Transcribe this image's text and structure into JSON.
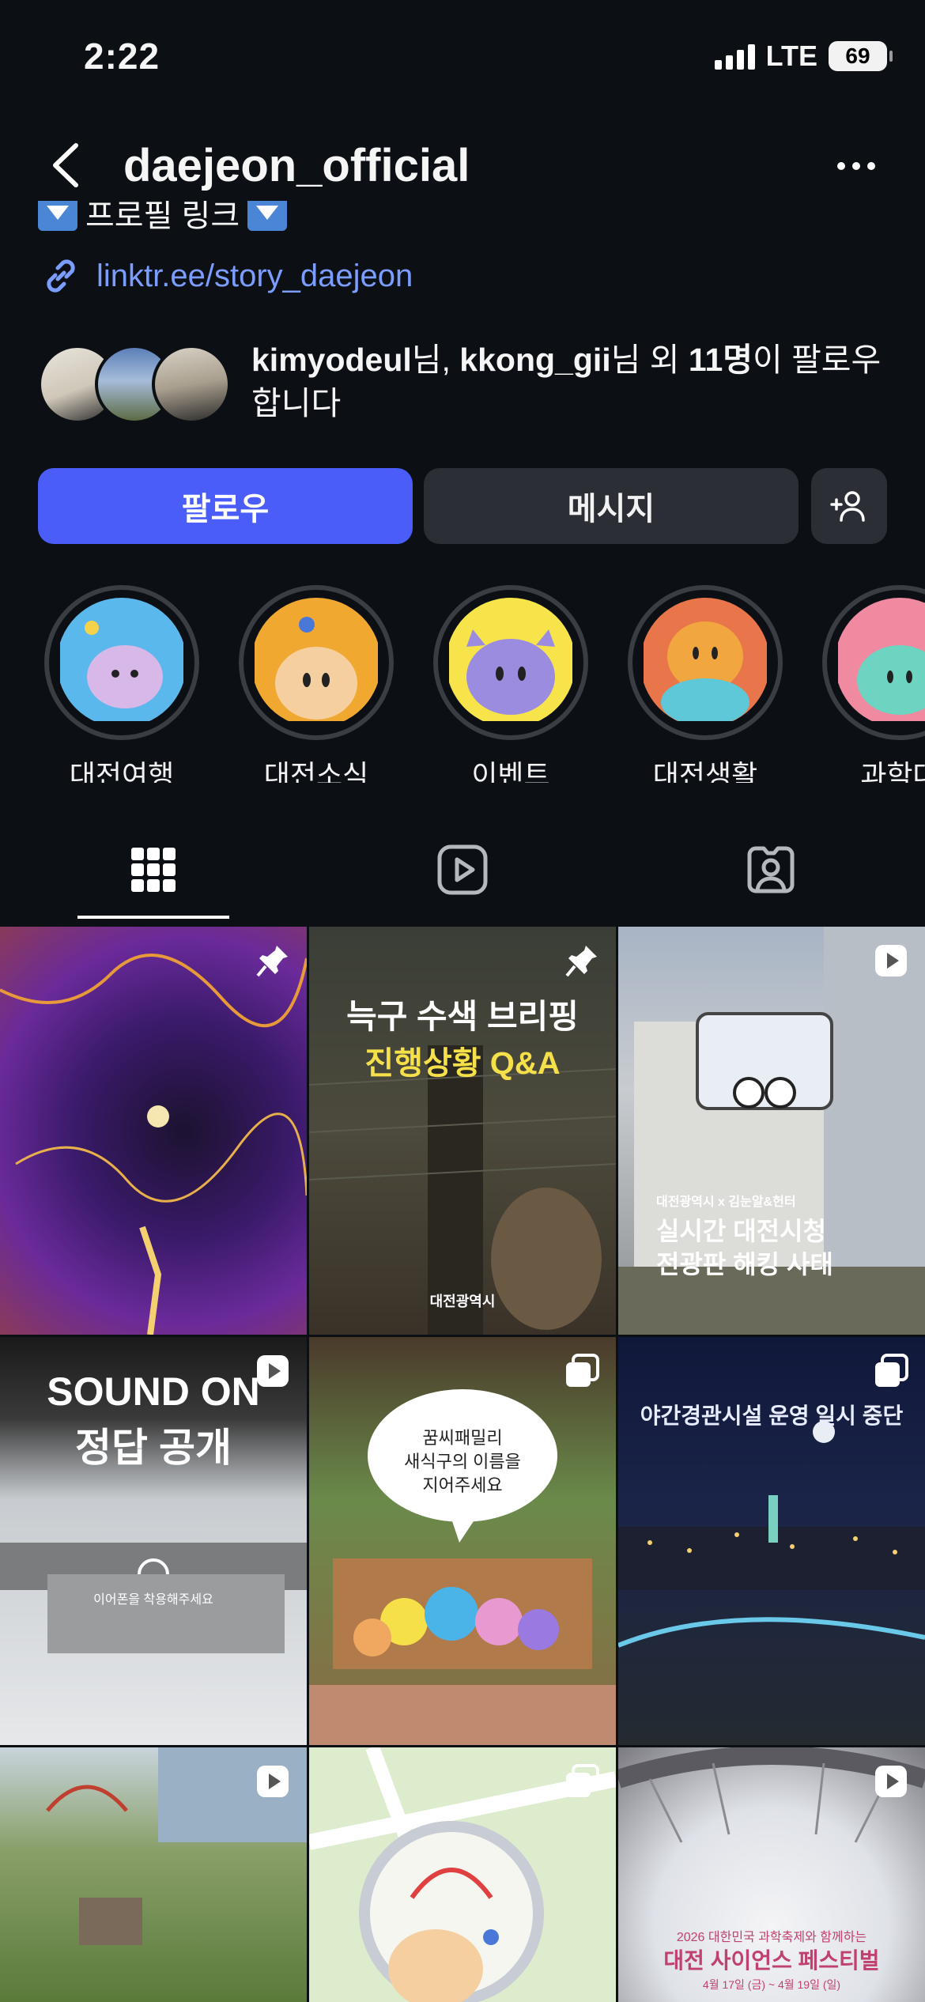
{
  "status": {
    "time": "2:22",
    "network": "LTE",
    "battery": "69"
  },
  "header": {
    "username": "daejeon_official"
  },
  "bio": {
    "line_cut": "프로필 링크",
    "link": "linktr.ee/story_daejeon"
  },
  "followed_by": {
    "user1": "kimyodeul",
    "sep1": "님, ",
    "user2": "kkong_gii",
    "sep2": "님 외 ",
    "count": "11명",
    "tail": "이 팔로우합니다"
  },
  "buttons": {
    "follow": "팔로우",
    "message": "메시지"
  },
  "highlights": [
    {
      "label": "대전여행",
      "color": "#5ab8ec"
    },
    {
      "label": "대전소식",
      "color": "#f0a830"
    },
    {
      "label": "이벤트",
      "color": "#f6e44a"
    },
    {
      "label": "대전생활",
      "color": "#e8764a"
    },
    {
      "label": "과학대",
      "color": "#f08aa0"
    }
  ],
  "tabs": [
    "grid-icon",
    "reels-icon",
    "tagged-icon"
  ],
  "posts": [
    {
      "type": "pinned",
      "text": ""
    },
    {
      "type": "pinned",
      "title1": "늑구 수색 브리핑",
      "title2": "진행상황 Q&A",
      "logo": "대전광역시"
    },
    {
      "type": "reel",
      "sub": "대전광역시 x 김눈알&헌터",
      "title1": "실시간 대전시청",
      "title2": "전광판 해킹 사태"
    },
    {
      "type": "reel",
      "title1": "SOUND ON",
      "title2": "정답 공개",
      "caption": "이어폰을 착용해주세요"
    },
    {
      "type": "carousel",
      "bubble1": "꿈씨패밀리",
      "bubble2": "새식구의 이름을",
      "bubble3": "지어주세요"
    },
    {
      "type": "carousel",
      "title1": "야간경관시설 운영 일시 중단"
    },
    {
      "type": "reel",
      "text": ""
    },
    {
      "type": "carousel",
      "text": ""
    },
    {
      "type": "reel",
      "sub": "2026 대한민국 과학축제와 함께하는",
      "title1": "대전 사이언스 페스티벌",
      "date": "4월 17일 (금) ~ 4월 19일 (일)"
    }
  ]
}
